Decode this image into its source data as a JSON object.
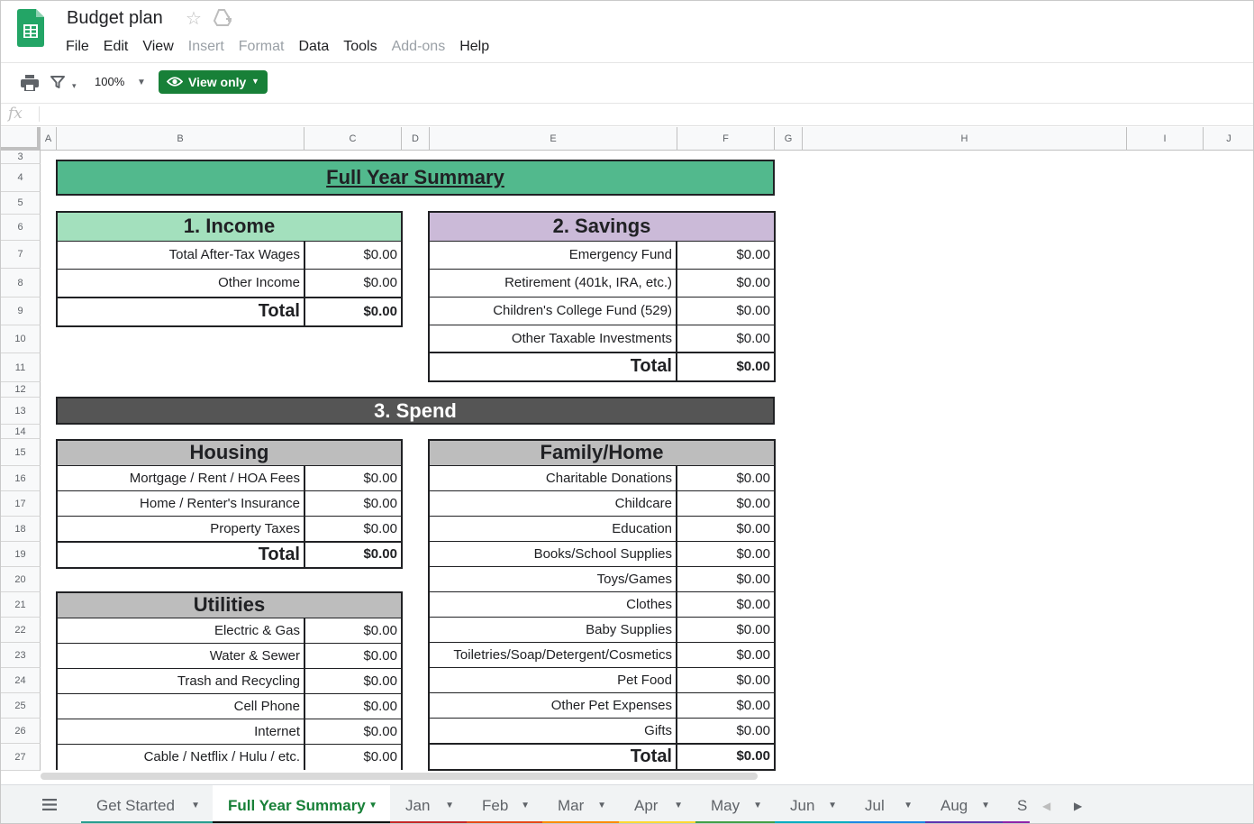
{
  "app": {
    "title": "Budget plan",
    "menu": [
      {
        "label": "File",
        "enabled": true
      },
      {
        "label": "Edit",
        "enabled": true
      },
      {
        "label": "View",
        "enabled": true
      },
      {
        "label": "Insert",
        "enabled": false
      },
      {
        "label": "Format",
        "enabled": false
      },
      {
        "label": "Data",
        "enabled": true
      },
      {
        "label": "Tools",
        "enabled": true
      },
      {
        "label": "Add-ons",
        "enabled": false
      },
      {
        "label": "Help",
        "enabled": true
      }
    ]
  },
  "toolbar": {
    "zoom": "100%",
    "view_only_label": "View only",
    "accent": "#188038"
  },
  "formula_bar": {
    "fx_label": "fx",
    "value": ""
  },
  "columns": [
    "A",
    "B",
    "C",
    "D",
    "E",
    "F",
    "G",
    "H",
    "I",
    "J"
  ],
  "rows": [
    "3",
    "4",
    "5",
    "6",
    "7",
    "8",
    "9",
    "10",
    "11",
    "12",
    "13",
    "14",
    "15",
    "16",
    "17",
    "18",
    "19",
    "20",
    "21",
    "22",
    "23",
    "24",
    "25",
    "26",
    "27"
  ],
  "sheet": {
    "banner": "Full Year Summary",
    "income": {
      "header": "1. Income",
      "rows": [
        {
          "label": "Total After-Tax Wages",
          "value": "$0.00"
        },
        {
          "label": "Other Income",
          "value": "$0.00"
        }
      ],
      "total": {
        "label": "Total",
        "value": "$0.00"
      }
    },
    "savings": {
      "header": "2. Savings",
      "rows": [
        {
          "label": "Emergency Fund",
          "value": "$0.00"
        },
        {
          "label": "Retirement (401k, IRA, etc.)",
          "value": "$0.00"
        },
        {
          "label": "Children's College Fund (529)",
          "value": "$0.00"
        },
        {
          "label": "Other Taxable Investments",
          "value": "$0.00"
        }
      ],
      "total": {
        "label": "Total",
        "value": "$0.00"
      }
    },
    "spend_banner": "3. Spend",
    "housing": {
      "header": "Housing",
      "rows": [
        {
          "label": "Mortgage / Rent / HOA Fees",
          "value": "$0.00"
        },
        {
          "label": "Home / Renter's Insurance",
          "value": "$0.00"
        },
        {
          "label": "Property Taxes",
          "value": "$0.00"
        }
      ],
      "total": {
        "label": "Total",
        "value": "$0.00"
      }
    },
    "utilities": {
      "header": "Utilities",
      "rows": [
        {
          "label": "Electric & Gas",
          "value": "$0.00"
        },
        {
          "label": "Water & Sewer",
          "value": "$0.00"
        },
        {
          "label": "Trash and Recycling",
          "value": "$0.00"
        },
        {
          "label": "Cell Phone",
          "value": "$0.00"
        },
        {
          "label": "Internet",
          "value": "$0.00"
        },
        {
          "label": "Cable / Netflix / Hulu / etc.",
          "value": "$0.00"
        }
      ]
    },
    "family": {
      "header": "Family/Home",
      "rows": [
        {
          "label": "Charitable Donations",
          "value": "$0.00"
        },
        {
          "label": "Childcare",
          "value": "$0.00"
        },
        {
          "label": "Education",
          "value": "$0.00"
        },
        {
          "label": "Books/School Supplies",
          "value": "$0.00"
        },
        {
          "label": "Toys/Games",
          "value": "$0.00"
        },
        {
          "label": "Clothes",
          "value": "$0.00"
        },
        {
          "label": "Baby Supplies",
          "value": "$0.00"
        },
        {
          "label": "Toiletries/Soap/Detergent/Cosmetics",
          "value": "$0.00"
        },
        {
          "label": "Pet Food",
          "value": "$0.00"
        },
        {
          "label": "Other Pet Expenses",
          "value": "$0.00"
        },
        {
          "label": "Gifts",
          "value": "$0.00"
        }
      ],
      "total": {
        "label": "Total",
        "value": "$0.00"
      }
    },
    "colors": {
      "banner": "#52b98d",
      "income_header": "#a3e0bd",
      "savings_header": "#cbbad8",
      "spend_banner": "#555555",
      "category_header": "#bdbdbd"
    }
  },
  "tabs": [
    {
      "label": "Get Started",
      "color": "#2a9d8f",
      "active": false
    },
    {
      "label": "Full Year Summary",
      "color": "#111111",
      "active": true
    },
    {
      "label": "Jan",
      "color": "#c62828",
      "active": false
    },
    {
      "label": "Feb",
      "color": "#e64a19",
      "active": false
    },
    {
      "label": "Mar",
      "color": "#fb8c00",
      "active": false
    },
    {
      "label": "Apr",
      "color": "#fdd835",
      "active": false
    },
    {
      "label": "May",
      "color": "#43a047",
      "active": false
    },
    {
      "label": "Jun",
      "color": "#00acc1",
      "active": false
    },
    {
      "label": "Jul",
      "color": "#1e88e5",
      "active": false
    },
    {
      "label": "Aug",
      "color": "#5e35b1",
      "active": false
    },
    {
      "label": "S",
      "color": "#8e24aa",
      "active": false
    }
  ]
}
